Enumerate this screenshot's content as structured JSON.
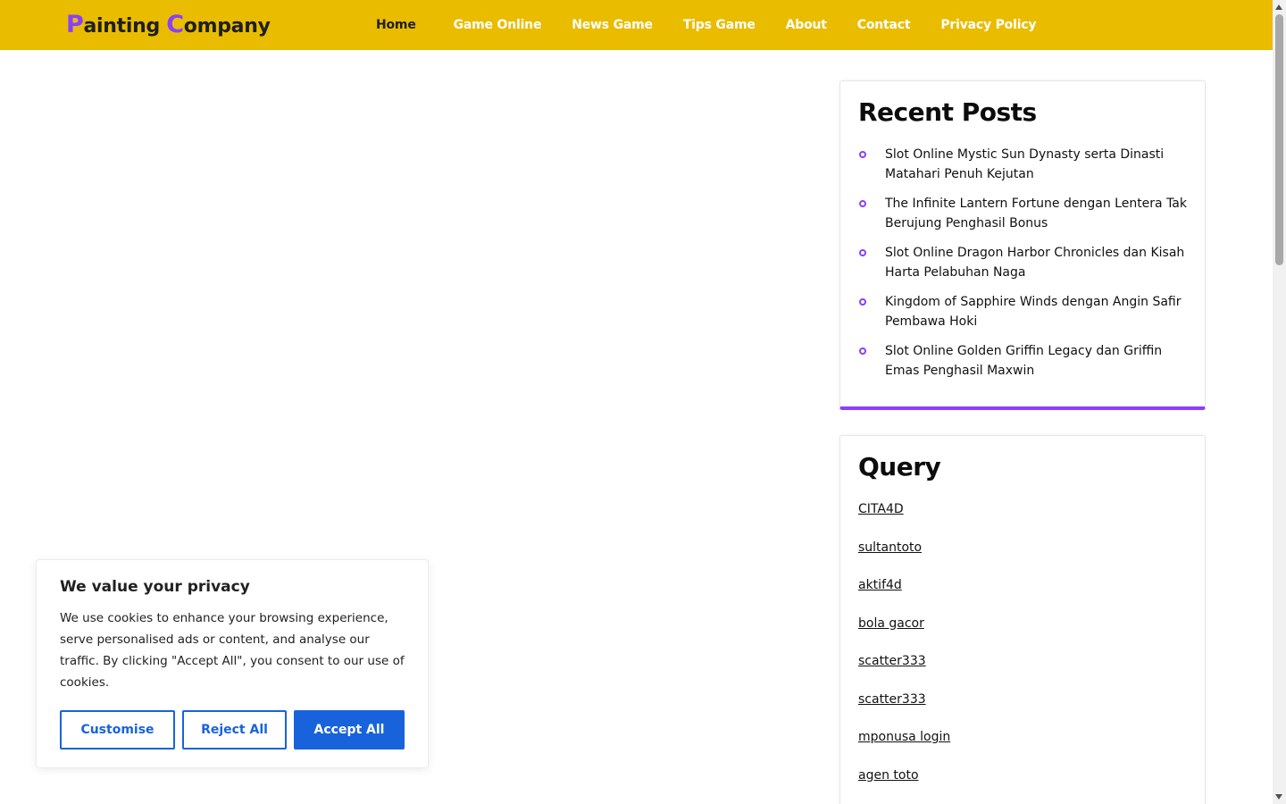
{
  "header": {
    "logo": {
      "first_cap": "P",
      "first_rest": "ainting ",
      "second_cap": "C",
      "second_rest": "ompany"
    },
    "nav": [
      {
        "label": "Home",
        "active": true
      },
      {
        "label": "Game Online"
      },
      {
        "label": "News Game"
      },
      {
        "label": "Tips Game"
      },
      {
        "label": "About"
      },
      {
        "label": "Contact"
      },
      {
        "label": "Privacy Policy"
      }
    ]
  },
  "sidebar": {
    "recent_posts": {
      "title": "Recent Posts",
      "items": [
        "Slot Online Mystic Sun Dynasty serta Dinasti Matahari Penuh Kejutan",
        "The Infinite Lantern Fortune dengan Lentera Tak Berujung Penghasil Bonus",
        "Slot Online Dragon Harbor Chronicles dan Kisah Harta Pelabuhan Naga",
        "Kingdom of Sapphire Winds dengan Angin Safir Pembawa Hoki",
        "Slot Online Golden Griffin Legacy dan Griffin Emas Penghasil Maxwin"
      ]
    },
    "query": {
      "title": "Query",
      "links": [
        "CITA4D",
        "sultantoto",
        "aktif4d",
        "bola gacor",
        "scatter333",
        "scatter333",
        "mponusa login",
        "agen toto"
      ]
    }
  },
  "cookie_banner": {
    "title": "We value your privacy",
    "text": "We use cookies to enhance your browsing experience, serve personalised ads or content, and analyse our traffic. By clicking \"Accept All\", you consent to our use of cookies.",
    "buttons": {
      "customise": "Customise",
      "reject": "Reject All",
      "accept": "Accept All"
    }
  },
  "colors": {
    "header_bg": "#e9bc00",
    "accent_purple": "#8a3ffc",
    "cookie_blue": "#1863dc"
  },
  "icons": {
    "bullet": "circle-bullet-icon",
    "scroll_up": "scroll-up-arrow-icon",
    "scroll_down": "scroll-down-arrow-icon"
  }
}
